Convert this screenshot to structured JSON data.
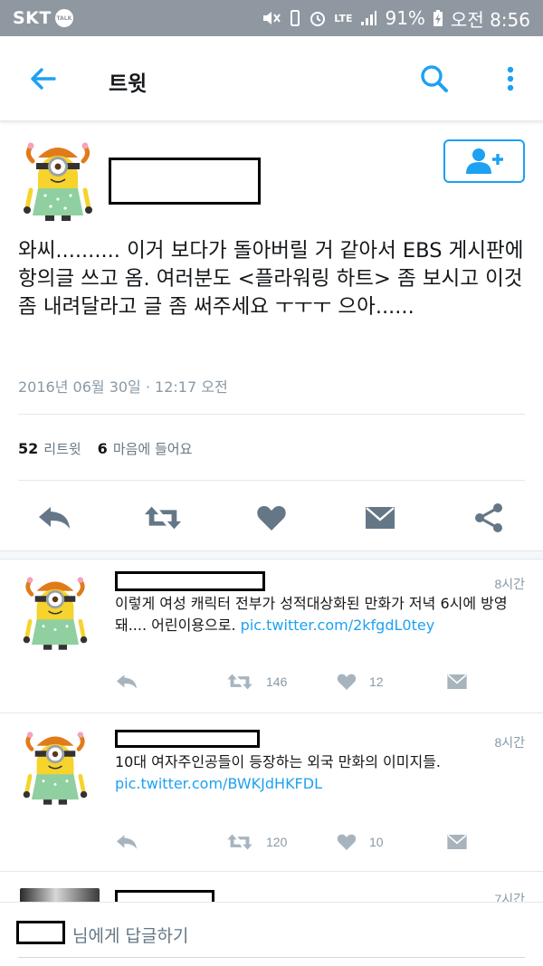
{
  "status_bar": {
    "carrier": "SKT",
    "carrier_badge": "TALK",
    "battery": "91%",
    "time": "오전 8:56",
    "network": "LTE",
    "icons": [
      "mute-icon",
      "vibrate-icon",
      "alarm-icon",
      "lte-icon",
      "signal-icon",
      "battery-charging-icon"
    ]
  },
  "app_bar": {
    "title": "트윗",
    "back_icon": "back-arrow-icon",
    "search_icon": "search-icon",
    "more_icon": "more-vertical-icon"
  },
  "main_tweet": {
    "text": "와씨.......... 이거 보다가 돌아버릴 거 같아서 EBS 게시판에 항의글 쓰고 옴. 여러분도 <플라워링 하트> 좀 보시고 이것 좀 내려달라고 글 좀 써주세요 ㅜㅜㅜ 으아......",
    "timestamp": "2016년 06월 30일 · 12:17 오전",
    "retweets": "52",
    "retweets_label": "리트윗",
    "likes": "6",
    "likes_label": "마음에 들어요",
    "follow_icon": "add-user-icon"
  },
  "replies": [
    {
      "time": "8시간",
      "text": "이렇게 여성 캐릭터 전부가 성적대상화된 만화가 저녁 6시에 방영돼.... 어린이용으로. ",
      "link": "pic.twitter.com/2kfgdL0tey",
      "retweets": "146",
      "likes": "12"
    },
    {
      "time": "8시간",
      "text": "10대 여자주인공들이 등장하는 외국 만화의 이미지들. ",
      "link": "pic.twitter.com/BWKJdHKFDL",
      "retweets": "120",
      "likes": "10"
    },
    {
      "time": "7시간"
    }
  ],
  "composer": {
    "placeholder_suffix": "님에게 답글하기"
  },
  "colors": {
    "accent": "#1da1f2",
    "status_bar": "#8f98a1",
    "icon_gray": "#8899a6",
    "main_icon_gray": "#657786"
  }
}
